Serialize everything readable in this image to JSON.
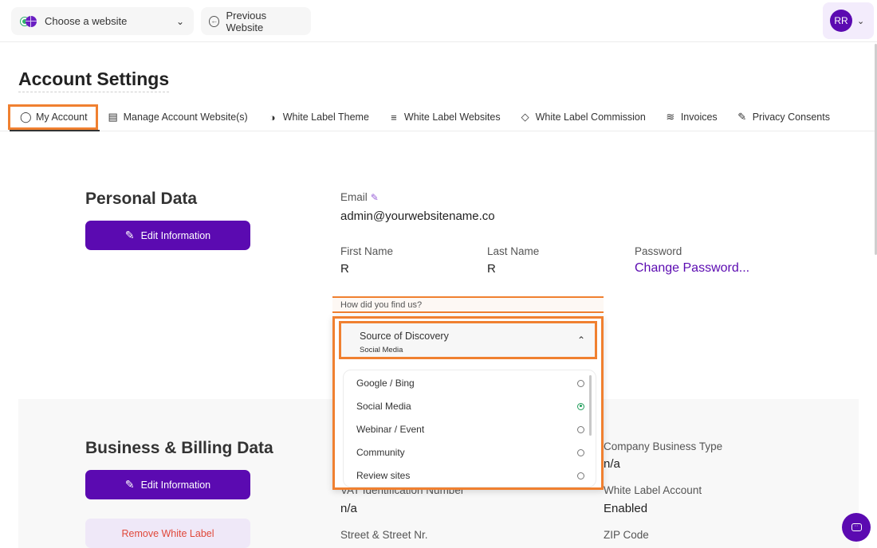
{
  "topbar": {
    "website_select": "Choose a website",
    "previous_website": "Previous Website",
    "user_initials": "RR"
  },
  "page": {
    "title": "Account Settings"
  },
  "tabs": [
    {
      "label": "My Account",
      "icon": "user-icon",
      "active": true
    },
    {
      "label": "Manage Account Website(s)",
      "icon": "stack-icon",
      "active": false
    },
    {
      "label": "White Label Theme",
      "icon": "contrast-icon",
      "active": false
    },
    {
      "label": "White Label Websites",
      "icon": "lines-icon",
      "active": false
    },
    {
      "label": "White Label Commission",
      "icon": "tag-icon",
      "active": false
    },
    {
      "label": "Invoices",
      "icon": "layers-icon",
      "active": false
    },
    {
      "label": "Privacy Consents",
      "icon": "pencil-icon",
      "active": false
    }
  ],
  "personal": {
    "title": "Personal Data",
    "edit_label": "Edit Information",
    "email_label": "Email",
    "email_value": "admin@yourwebsitename.co",
    "first_name_label": "First Name",
    "first_name_value": "R",
    "last_name_label": "Last Name",
    "last_name_value": "R",
    "password_label": "Password",
    "password_link": "Change Password...",
    "how_found_label": "How did you find us?"
  },
  "discovery": {
    "label": "Source of Discovery",
    "selected": "Social Media",
    "options": [
      {
        "label": "Google / Bing",
        "selected": false
      },
      {
        "label": "Social Media",
        "selected": true
      },
      {
        "label": "Webinar / Event",
        "selected": false
      },
      {
        "label": "Community",
        "selected": false
      },
      {
        "label": "Review sites",
        "selected": false
      }
    ]
  },
  "billing": {
    "title": "Business & Billing Data",
    "edit_label": "Edit Information",
    "remove_label": "Remove White Label",
    "vat_label": "VAT Identification Number",
    "vat_value": "n/a",
    "street_label": "Street & Street Nr.",
    "company_type_label": "Company Business Type",
    "company_type_value": "n/a",
    "white_label_label": "White Label Account",
    "white_label_value": "Enabled",
    "zip_label": "ZIP Code"
  },
  "colors": {
    "brand": "#5b0ab1",
    "highlight": "#f08030",
    "danger": "#e0483a",
    "success": "#1f9d5a"
  }
}
